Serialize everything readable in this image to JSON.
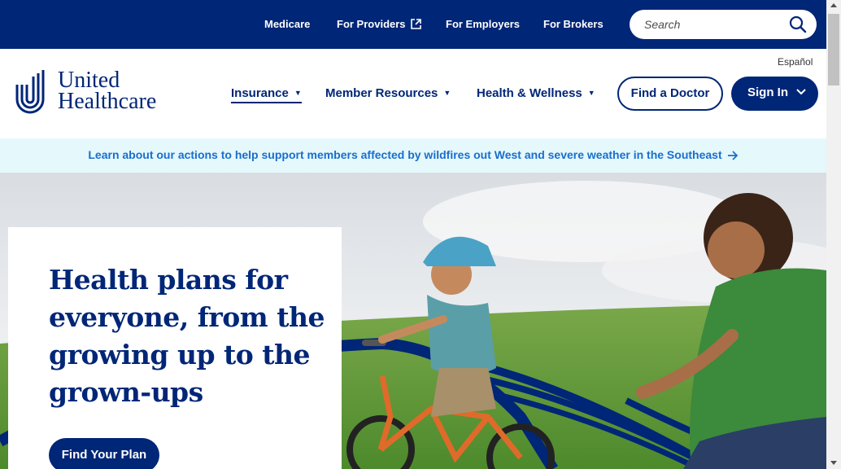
{
  "topbar": {
    "links": [
      "Medicare",
      "For Providers",
      "For Employers",
      "For Brokers"
    ],
    "search_placeholder": "Search",
    "search_icon": "search-icon",
    "external_icon": "external-link-icon"
  },
  "header": {
    "logo_line1": "United",
    "logo_line2": "Healthcare",
    "language_link": "Español",
    "nav": {
      "insurance": "Insurance",
      "member_resources": "Member Resources",
      "health_wellness": "Health & Wellness"
    },
    "find_doctor": "Find a Doctor",
    "sign_in": "Sign In"
  },
  "banner": {
    "text": "Learn about our actions to help support members affected by wildfires out West and severe weather in the Southeast"
  },
  "hero": {
    "title": "Health plans for everyone, from the growing up to the grown-ups",
    "cta": "Find Your Plan"
  },
  "colors": {
    "brand_navy": "#002677",
    "banner_bg": "#e5f8fb",
    "banner_link": "#196ecf"
  }
}
